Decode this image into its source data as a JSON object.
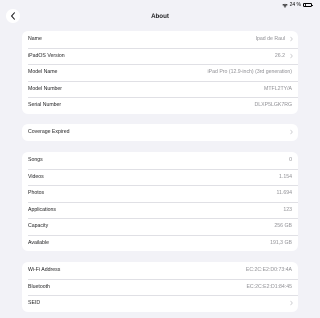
{
  "status_bar": {
    "battery": "24 %",
    "battery_level": 0.24
  },
  "nav": {
    "title": "About"
  },
  "group1": [
    {
      "label": "Name",
      "value": "Ipad de Raul",
      "chevron": true
    },
    {
      "label": "iPadOS Version",
      "value": "26.2",
      "chevron": true
    },
    {
      "label": "Model Name",
      "value": "iPad Pro (12.9-inch) (3rd generation)",
      "chevron": false
    },
    {
      "label": "Model Number",
      "value": "MTFL2TY/A",
      "chevron": false
    },
    {
      "label": "Serial Number",
      "value": "DLXP5LGK7RG",
      "chevron": false
    }
  ],
  "group2": [
    {
      "label": "Coverage Expired",
      "value": "",
      "chevron": true
    }
  ],
  "group3": [
    {
      "label": "Songs",
      "value": "0",
      "chevron": false
    },
    {
      "label": "Videos",
      "value": "1.154",
      "chevron": false
    },
    {
      "label": "Photos",
      "value": "11.694",
      "chevron": false
    },
    {
      "label": "Applications",
      "value": "123",
      "chevron": false
    },
    {
      "label": "Capacity",
      "value": "256 GB",
      "chevron": false
    },
    {
      "label": "Available",
      "value": "191,3 GB",
      "chevron": false
    }
  ],
  "group4": [
    {
      "label": "Wi-Fi Address",
      "value": "EC:2C:E2:D0:73:4A",
      "chevron": false
    },
    {
      "label": "Bluetooth",
      "value": "EC:2C:E2:D1:84:45",
      "chevron": false
    },
    {
      "label": "SEID",
      "value": "",
      "chevron": true
    }
  ]
}
